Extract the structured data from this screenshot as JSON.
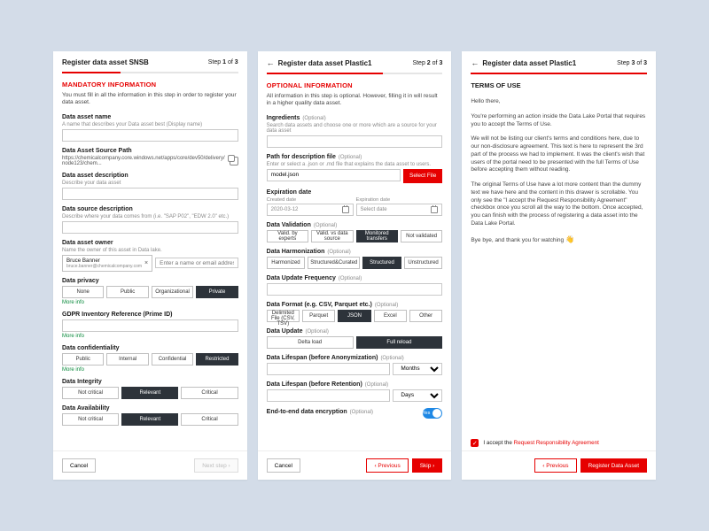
{
  "p1": {
    "title": "Register data asset SNSB",
    "step": "Step 1 of 3",
    "section": "MANDATORY INFORMATION",
    "intro": "You must fill in all the information in this step in order to register your data asset.",
    "name_label": "Data asset name",
    "name_hint": "A name that describes your Data asset best (Display name)",
    "path_label": "Data Asset Source Path",
    "path_url": "https://chemicalcompany.core.windows.net/apps/core/dev50/delivery/node123/chem...",
    "desc_label": "Data asset description",
    "desc_hint": "Describe your data asset",
    "src_label": "Data source description",
    "src_hint": "Describe where your data comes from (i.e. \"SAP P02\", \"EDW 2.0\" etc.)",
    "owner_label": "Data asset owner",
    "owner_hint": "Name the owner of this asset in Data lake.",
    "owner_chip_name": "Bruce Banner",
    "owner_chip_email": "bruce.banner@chemicalcompany.com",
    "owner_placeholder": "Enter a name or email address",
    "privacy_label": "Data privacy",
    "privacy_opts": [
      "None",
      "Public",
      "Organizational",
      "Private"
    ],
    "gdpr_label": "GDPR Inventory Reference (Prime ID)",
    "conf_label": "Data confidentiality",
    "conf_opts": [
      "Public",
      "Internal",
      "Confidential",
      "Restricted"
    ],
    "integrity_label": "Data Integrity",
    "avail_label": "Data Availability",
    "tri_opts": [
      "Not critical",
      "Relevant",
      "Critical"
    ],
    "more": "More info",
    "cancel": "Cancel",
    "next": "Next step  ›"
  },
  "p2": {
    "title": "Register data asset Plastic1",
    "step": "Step 2 of 3",
    "section": "OPTIONAL INFORMATION",
    "intro": "All information in this step is optional. However, filling it in will result in a higher quality data asset.",
    "opt": "(Optional)",
    "ing_label": "Ingredients",
    "ing_hint": "Search data assets and choose one or more which are a source for your data asset",
    "pdf_label": "Path for description file",
    "pdf_hint": "Enter or select a .json or .md file that explains the data asset to users.",
    "pdf_value": "model.json",
    "select_file": "Select File",
    "exp_label": "Expiration date",
    "created_l": "Created date",
    "created_v": "2020-03-12",
    "expires_l": "Expiration date",
    "expires_ph": "Select date",
    "valid_label": "Data Validation",
    "valid_opts": [
      "Valid. by experts",
      "Valid. vs data source",
      "Monitored transfers",
      "Not validated"
    ],
    "harm_label": "Data Harmonization",
    "harm_opts": [
      "Harmonized",
      "Structured&Curated",
      "Structured",
      "Unstructured"
    ],
    "freq_label": "Data Update Frequency",
    "fmt_label": "Data Format (e.g. CSV, Parquet etc.)",
    "fmt_opts": [
      "Delimited File (CSV, TSV)",
      "Parquet",
      "JSON",
      "Excel",
      "Other"
    ],
    "upd_label": "Data Update",
    "upd_opts": [
      "Delta load",
      "Full reload"
    ],
    "life_anon": "Data Lifespan (before Anonymization)",
    "life_ret": "Data Lifespan (before Retention)",
    "months": "Months",
    "days": "Days",
    "enc_label": "End-to-end data encryption",
    "toggle_text": "Yes",
    "cancel": "Cancel",
    "prev": "‹  Previous",
    "skip": "Skip  ›"
  },
  "p3": {
    "title": "Register data asset Plastic1",
    "step": "Step 3 of 3",
    "section": "TERMS OF USE",
    "greeting": "Hello there,",
    "pg1": "You're performing an action inside the Data Lake Portal that requires you to accept the Terms of Use.",
    "pg2": "We will not be listing our client's terms and conditions here, due to our non-disclosure agreement. This text is here to represent the 3rd part of the process we had to implement. It was the client's wish that users of the portal need to be presented with the full Terms of Use before accepting them without reading.",
    "pg3": "The original Terms of Use have a lot more content than the dummy text we have here and the content in this drawer is scrollable. You only see the \"I accept the Request Responsibility Agreement\" checkbox once you scroll all the way to the bottom. Once accepted, you can finish with the process of registering a data asset into the Data Lake Portal.",
    "pg4": "Bye bye, and thank you for watching",
    "accept_prefix": "I accept the",
    "accept_link": "Request Responsibility Agreement",
    "prev": "‹  Previous",
    "register": "Register Data Asset"
  }
}
